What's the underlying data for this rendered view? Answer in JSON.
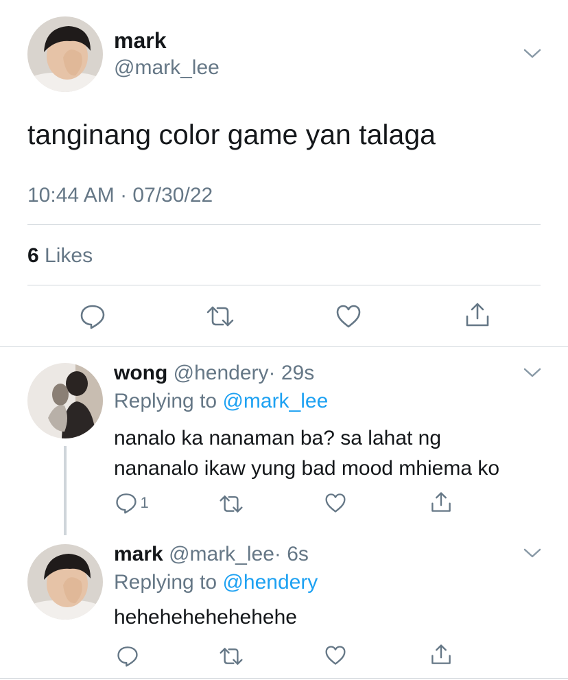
{
  "main_tweet": {
    "display_name": "mark",
    "handle": "@mark_lee",
    "text": "tanginang color game yan talaga",
    "timestamp": "10:44 AM · 07/30/22",
    "likes_count": "6",
    "likes_label": "Likes"
  },
  "replies": [
    {
      "display_name": "wong",
      "handle": "@hendery",
      "time": "· 29s",
      "replying_to_label": "Replying to",
      "replying_to_handle": "@mark_lee",
      "text_line1": "nanalo ka nanaman ba? sa lahat ng",
      "text_line2": "nananalo ikaw yung bad mood mhiema ko",
      "reply_count": "1"
    },
    {
      "display_name": "mark",
      "handle": "@mark_lee",
      "time": "· 6s",
      "replying_to_label": "Replying to",
      "replying_to_handle": "@hendery",
      "text": "hehehehehehehehe"
    }
  ],
  "icons": [
    "chevron-down-icon",
    "reply-icon",
    "retweet-icon",
    "like-icon",
    "share-icon"
  ],
  "colors": {
    "text": "#14171a",
    "secondary": "#657786",
    "link": "#1da1f2",
    "divider": "#cfd5da"
  }
}
